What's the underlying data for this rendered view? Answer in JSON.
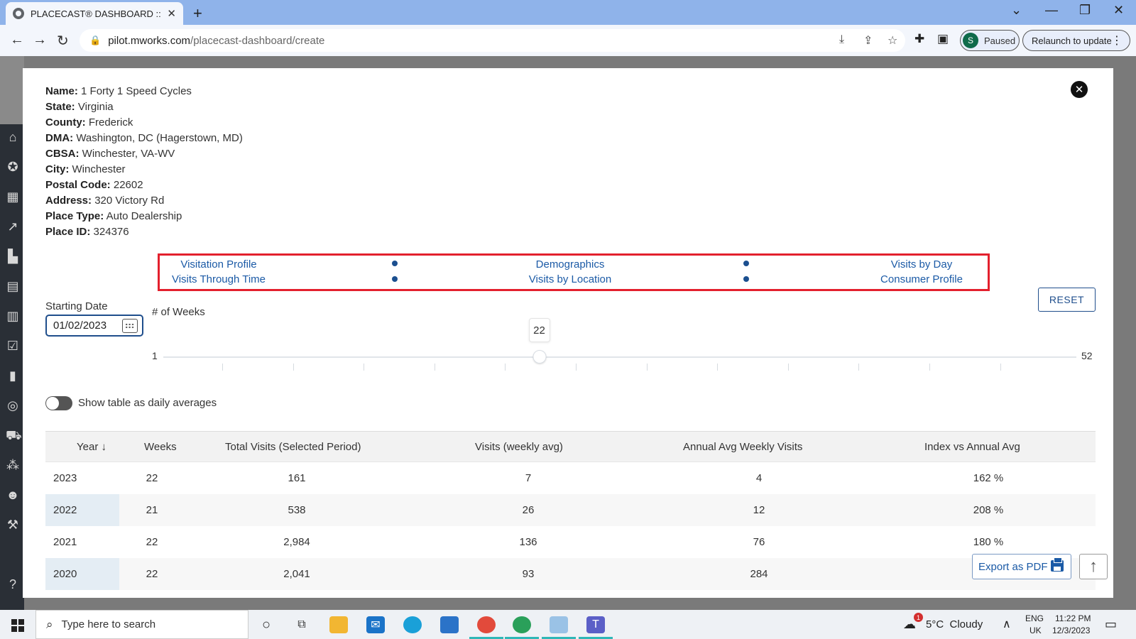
{
  "browser": {
    "tab_title": "PLACECAST® DASHBOARD :: M",
    "url_host": "pilot.mworks.com",
    "url_path": "/placecast-dashboard/create",
    "profile_initial": "S",
    "profile_status": "Paused",
    "relaunch_label": "Relaunch to update"
  },
  "info": {
    "name_label": "Name:",
    "name": "1 Forty 1 Speed Cycles",
    "state_label": "State:",
    "state": "Virginia",
    "county_label": "County:",
    "county": "Frederick",
    "dma_label": "DMA:",
    "dma": "Washington, DC (Hagerstown, MD)",
    "cbsa_label": "CBSA:",
    "cbsa": "Winchester, VA-WV",
    "city_label": "City:",
    "city": "Winchester",
    "postal_label": "Postal Code:",
    "postal": "22602",
    "address_label": "Address:",
    "address": "320 Victory Rd",
    "placetype_label": "Place Type:",
    "placetype": "Auto Dealership",
    "placeid_label": "Place ID:",
    "placeid": "324376"
  },
  "nav": {
    "visitation_profile": "Visitation Profile",
    "demographics": "Demographics",
    "visits_by_day": "Visits by Day",
    "visits_through_time": "Visits Through Time",
    "visits_by_location": "Visits by Location",
    "consumer_profile": "Consumer Profile"
  },
  "controls": {
    "starting_date_label": "Starting Date",
    "starting_date": "01/02/2023",
    "weeks_label": "# of Weeks",
    "reset_label": "RESET",
    "slider_min": "1",
    "slider_max": "52",
    "slider_value": 22,
    "toggle_label": "Show table as daily averages"
  },
  "table": {
    "headers": {
      "year": "Year",
      "weeks": "Weeks",
      "total": "Total Visits (Selected Period)",
      "weekly": "Visits (weekly avg)",
      "annual": "Annual Avg Weekly Visits",
      "index": "Index vs Annual Avg"
    },
    "rows": [
      {
        "year": "2023",
        "weeks": "22",
        "total": "161",
        "weekly": "7",
        "annual": "4",
        "index": "162 %"
      },
      {
        "year": "2022",
        "weeks": "21",
        "total": "538",
        "weekly": "26",
        "annual": "12",
        "index": "208 %"
      },
      {
        "year": "2021",
        "weeks": "22",
        "total": "2,984",
        "weekly": "136",
        "annual": "76",
        "index": "180 %"
      },
      {
        "year": "2020",
        "weeks": "22",
        "total": "2,041",
        "weekly": "93",
        "annual": "284",
        "index": ""
      }
    ]
  },
  "actions": {
    "export_label": "Export as PDF"
  },
  "taskbar": {
    "search_placeholder": "Type here to search",
    "weather": "5°C  Cloudy",
    "weather_badge": "1",
    "lang_top": "ENG",
    "lang_bottom": "UK",
    "time": "11:22 PM",
    "date": "12/3/2023"
  }
}
